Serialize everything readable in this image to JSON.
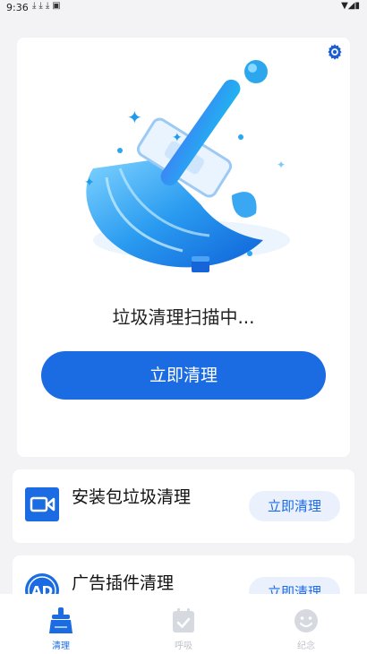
{
  "status_bar": {
    "time": "9:36"
  },
  "hero": {
    "scan_status": "垃圾清理扫描中...",
    "clean_button": "立即清理"
  },
  "tasks": [
    {
      "title": "安装包垃圾清理",
      "button": "立即清理",
      "icon": "video-file-icon"
    },
    {
      "title": "广告插件清理",
      "button": "立即清理",
      "icon": "ad-icon"
    }
  ],
  "bottom_nav": [
    {
      "label": "清理",
      "icon": "clean-icon",
      "active": true
    },
    {
      "label": "呼吸",
      "icon": "calendar-check-icon",
      "active": false
    },
    {
      "label": "纪念",
      "icon": "smile-icon",
      "active": false
    }
  ],
  "colors": {
    "accent": "#1b6be3",
    "background": "#f3f3f6",
    "inactive": "#bfc3ca"
  }
}
